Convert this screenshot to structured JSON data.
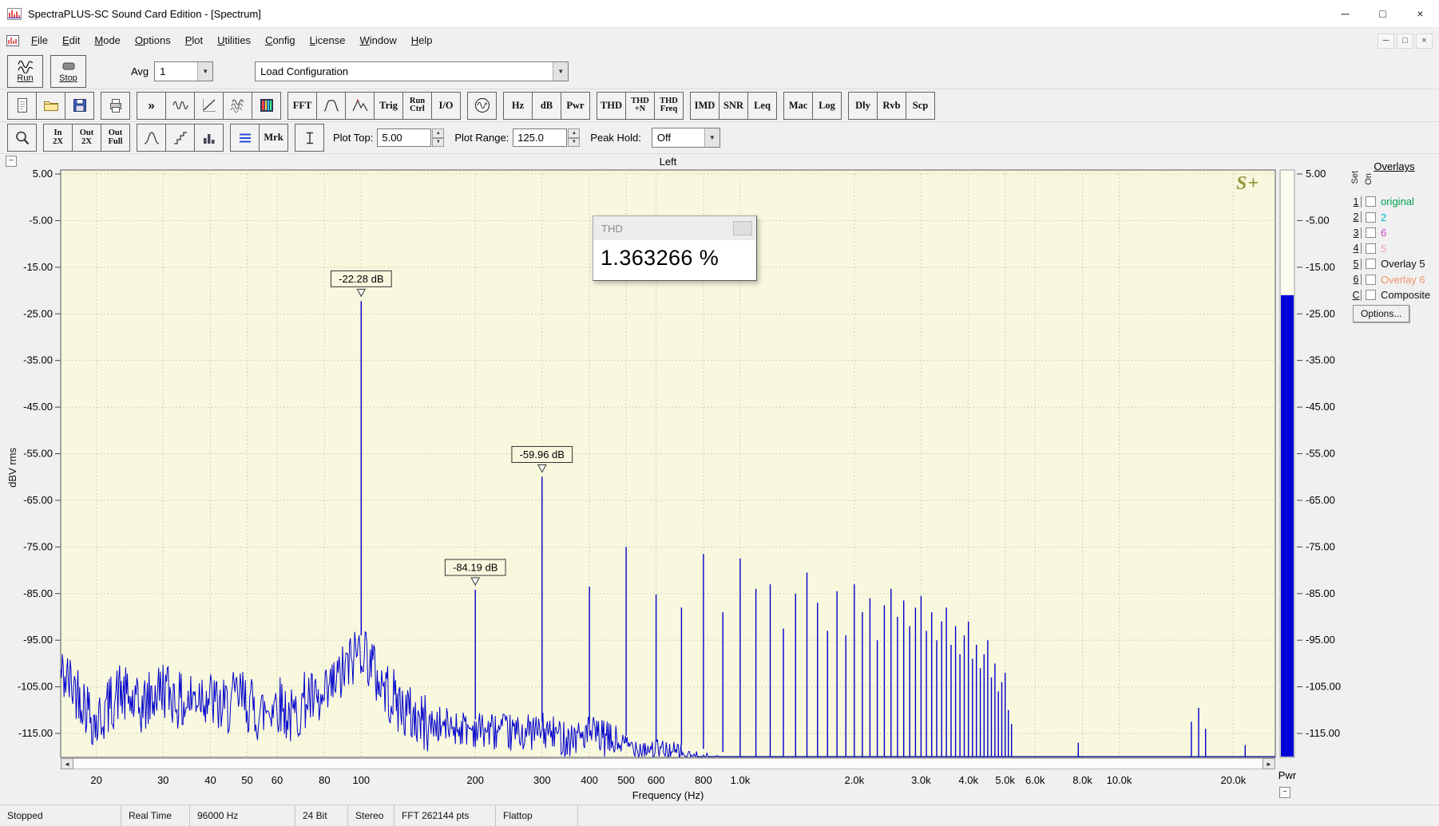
{
  "window": {
    "title": "SpectraPLUS-SC Sound Card Edition - [Spectrum]",
    "controls": {
      "minimize": "─",
      "maximize": "□",
      "close": "×"
    }
  },
  "menu": {
    "items": [
      "File",
      "Edit",
      "Mode",
      "Options",
      "Plot",
      "Utilities",
      "Config",
      "License",
      "Window",
      "Help"
    ],
    "mdi_controls": {
      "minimize": "─",
      "restore": "□",
      "close": "×"
    }
  },
  "toolbar_main": {
    "run_label": "Run",
    "stop_label": "Stop",
    "avg_label": "Avg",
    "avg_value": "1",
    "config_value": "Load Configuration",
    "dropdown_arrow": "▼"
  },
  "toolbar_buttons": {
    "groups": [
      [
        {
          "name": "new-file",
          "icon": "page"
        },
        {
          "name": "open-file",
          "icon": "folder"
        },
        {
          "name": "save-file",
          "icon": "floppy"
        }
      ],
      [
        {
          "name": "print",
          "icon": "printer"
        }
      ],
      [
        {
          "name": "post-process",
          "glyph": "»"
        },
        {
          "name": "time-series",
          "icon": "wavesel"
        },
        {
          "name": "phase-plot",
          "icon": "phase"
        },
        {
          "name": "waterfall",
          "icon": "waterfall"
        },
        {
          "name": "spectrogram",
          "icon": "spectrogram"
        }
      ],
      [
        {
          "name": "fft-settings",
          "label": "FFT"
        },
        {
          "name": "window-function",
          "icon": "winfn"
        },
        {
          "name": "peak-marker",
          "icon": "peakflag"
        },
        {
          "name": "trigger",
          "label": "Trig"
        },
        {
          "name": "run-control",
          "top": "Run",
          "bottom": "Ctrl"
        },
        {
          "name": "io-settings",
          "label": "I/O"
        }
      ],
      [
        {
          "name": "signal-generator",
          "icon": "generator"
        }
      ],
      [
        {
          "name": "hz-units",
          "label": "Hz"
        },
        {
          "name": "db-units",
          "label": "dB"
        },
        {
          "name": "power-units",
          "label": "Pwr"
        }
      ],
      [
        {
          "name": "thd",
          "label": "THD"
        },
        {
          "name": "thd-n",
          "top": "THD",
          "bottom": "+N"
        },
        {
          "name": "thd-freq",
          "top": "THD",
          "bottom": "Freq"
        }
      ],
      [
        {
          "name": "imd",
          "label": "IMD"
        },
        {
          "name": "snr",
          "label": "SNR"
        },
        {
          "name": "leq",
          "label": "Leq"
        }
      ],
      [
        {
          "name": "macro",
          "label": "Mac"
        },
        {
          "name": "logging",
          "label": "Log"
        }
      ],
      [
        {
          "name": "delay",
          "label": "Dly"
        },
        {
          "name": "reverb",
          "label": "Rvb"
        },
        {
          "name": "scope",
          "label": "Scp"
        }
      ]
    ]
  },
  "toolbar_display": {
    "groups": [
      [
        {
          "name": "zoom",
          "icon": "magnifier"
        }
      ],
      [
        {
          "name": "input-2x",
          "top": "In",
          "bottom": "2X"
        },
        {
          "name": "output-2x",
          "top": "Out",
          "bottom": "2X"
        },
        {
          "name": "output-full",
          "top": "Out",
          "bottom": "Full"
        }
      ],
      [
        {
          "name": "distribution",
          "icon": "bell"
        },
        {
          "name": "step-plot",
          "icon": "steps"
        },
        {
          "name": "histogram",
          "icon": "bars"
        }
      ],
      [
        {
          "name": "notes",
          "icon": "lines"
        },
        {
          "name": "markers",
          "label": "Mrk"
        }
      ],
      [
        {
          "name": "measure",
          "icon": "ibeam"
        }
      ]
    ],
    "plot_top_label": "Plot Top:",
    "plot_top_value": "5.00",
    "plot_range_label": "Plot Range:",
    "plot_range_value": "125.0",
    "peak_hold_label": "Peak Hold:",
    "peak_hold_value": "Off",
    "spin_up": "▲",
    "spin_down": "▼"
  },
  "plot": {
    "collapse_glyph": "−",
    "scroll_left": "◄",
    "scroll_right": "►",
    "logo": "S+"
  },
  "meter": {
    "label": "Pwr",
    "level_db": -21.0,
    "color": "#0000d8",
    "collapse_glyph": "−"
  },
  "overlays": {
    "title": "Overlays",
    "col_set": "Set",
    "col_on": "On",
    "rows": [
      {
        "num": "1",
        "label": "original",
        "color": "#00a050"
      },
      {
        "num": "2",
        "label": "2",
        "color": "#00b4c8"
      },
      {
        "num": "3",
        "label": "6",
        "color": "#cc44cc"
      },
      {
        "num": "4",
        "label": "5",
        "color": "#f49ac1"
      },
      {
        "num": "5",
        "label": "Overlay 5",
        "color": "#111111"
      },
      {
        "num": "6",
        "label": "Overlay 6",
        "color": "#f0946a"
      },
      {
        "num": "C",
        "label": "Composite",
        "color": "#111111"
      }
    ],
    "options_button": "Options..."
  },
  "thd_window": {
    "title": "THD",
    "value": "1.363266 %"
  },
  "status_bar": {
    "cells": [
      "Stopped",
      "Real Time",
      "96000 Hz",
      "24 Bit",
      "Stereo",
      "FFT 262144 pts",
      "Flattop"
    ]
  },
  "chart_data": {
    "type": "line",
    "title": "Left",
    "xlabel": "Frequency (Hz)",
    "ylabel": "dBV rms",
    "x_scale": "log",
    "xlim": [
      16.1,
      25800
    ],
    "ylim": [
      -120,
      5.9
    ],
    "plot_bg": "#f8f8df",
    "trace_color": "#0000cc",
    "grid_color": "#c5c5ae",
    "x_ticks": [
      "20",
      "30",
      "40",
      "50",
      "60",
      "80",
      "100",
      "200",
      "300",
      "400",
      "500",
      "600",
      "800",
      "1.0k",
      "2.0k",
      "3.0k",
      "4.0k",
      "5.0k",
      "6.0k",
      "8.0k",
      "10.0k",
      "20.0k"
    ],
    "x_tick_values": [
      20,
      30,
      40,
      50,
      60,
      80,
      100,
      200,
      300,
      400,
      500,
      600,
      800,
      1000,
      2000,
      3000,
      4000,
      5000,
      6000,
      8000,
      10000,
      20000
    ],
    "y_ticks": [
      5,
      -5,
      -15,
      -25,
      -35,
      -45,
      -55,
      -65,
      -75,
      -85,
      -95,
      -105,
      -115
    ],
    "callouts": [
      {
        "freq": 100,
        "level": -22.28,
        "label": "-22.28 dB"
      },
      {
        "freq": 300,
        "level": -59.96,
        "label": "-59.96 dB"
      },
      {
        "freq": 200,
        "level": -84.19,
        "label": "-84.19 dB"
      }
    ],
    "harmonics": [
      [
        100,
        -22.28
      ],
      [
        200,
        -84.19
      ],
      [
        300,
        -59.96
      ],
      [
        400,
        -83.5
      ],
      [
        500,
        -75.0
      ],
      [
        600,
        -85.2
      ],
      [
        700,
        -88.0
      ],
      [
        800,
        -76.5
      ],
      [
        900,
        -89.0
      ],
      [
        1000,
        -77.5
      ],
      [
        1100,
        -84.0
      ],
      [
        1200,
        -83.0
      ],
      [
        1300,
        -92.5
      ],
      [
        1400,
        -85.0
      ],
      [
        1500,
        -80.5
      ],
      [
        1600,
        -87.0
      ],
      [
        1700,
        -93.0
      ],
      [
        1800,
        -84.5
      ],
      [
        1900,
        -94.0
      ],
      [
        2000,
        -83.0
      ],
      [
        2100,
        -89.0
      ],
      [
        2200,
        -86.0
      ],
      [
        2300,
        -95.0
      ],
      [
        2400,
        -87.5
      ],
      [
        2500,
        -84.0
      ],
      [
        2600,
        -90.0
      ],
      [
        2700,
        -86.5
      ],
      [
        2800,
        -92.0
      ],
      [
        2900,
        -88.0
      ],
      [
        3000,
        -85.5
      ],
      [
        3100,
        -93.0
      ],
      [
        3200,
        -89.0
      ],
      [
        3300,
        -95.0
      ],
      [
        3400,
        -91.0
      ],
      [
        3500,
        -88.0
      ],
      [
        3600,
        -96.0
      ],
      [
        3700,
        -92.0
      ],
      [
        3800,
        -98.0
      ],
      [
        3900,
        -94.0
      ],
      [
        4000,
        -91.0
      ],
      [
        4100,
        -99.0
      ],
      [
        4200,
        -96.0
      ],
      [
        4300,
        -101.0
      ],
      [
        4400,
        -98.0
      ],
      [
        4500,
        -95.0
      ],
      [
        4600,
        -103.0
      ],
      [
        4700,
        -100.0
      ],
      [
        4800,
        -106.0
      ],
      [
        4900,
        -104.0
      ],
      [
        5000,
        -102.0
      ],
      [
        5100,
        -110.0
      ],
      [
        5200,
        -113.0
      ],
      [
        7800,
        -117.0
      ],
      [
        15500,
        -112.5
      ],
      [
        16200,
        -109.5
      ],
      [
        16900,
        -114.0
      ],
      [
        21500,
        -117.5
      ]
    ],
    "noise_floor": [
      [
        16,
        -102
      ],
      [
        18,
        -106
      ],
      [
        20,
        -113
      ],
      [
        23,
        -106
      ],
      [
        26,
        -110
      ],
      [
        30,
        -105
      ],
      [
        34,
        -109
      ],
      [
        38,
        -106
      ],
      [
        43,
        -110
      ],
      [
        48,
        -107
      ],
      [
        54,
        -111
      ],
      [
        60,
        -108
      ],
      [
        66,
        -112
      ],
      [
        72,
        -107
      ],
      [
        78,
        -110
      ],
      [
        84,
        -105
      ],
      [
        90,
        -102
      ],
      [
        95,
        -99
      ],
      [
        100,
        -96
      ],
      [
        105,
        -99
      ],
      [
        110,
        -103
      ],
      [
        120,
        -107
      ],
      [
        130,
        -110
      ],
      [
        140,
        -112
      ],
      [
        150,
        -113
      ],
      [
        200,
        -114
      ],
      [
        250,
        -115
      ],
      [
        300,
        -114.5
      ],
      [
        350,
        -116
      ],
      [
        400,
        -115
      ],
      [
        450,
        -116.5
      ],
      [
        500,
        -117.5
      ],
      [
        600,
        -118.5
      ],
      [
        700,
        -119.5
      ],
      [
        900,
        -121
      ],
      [
        1200,
        -124
      ],
      [
        25800,
        -127
      ]
    ]
  }
}
